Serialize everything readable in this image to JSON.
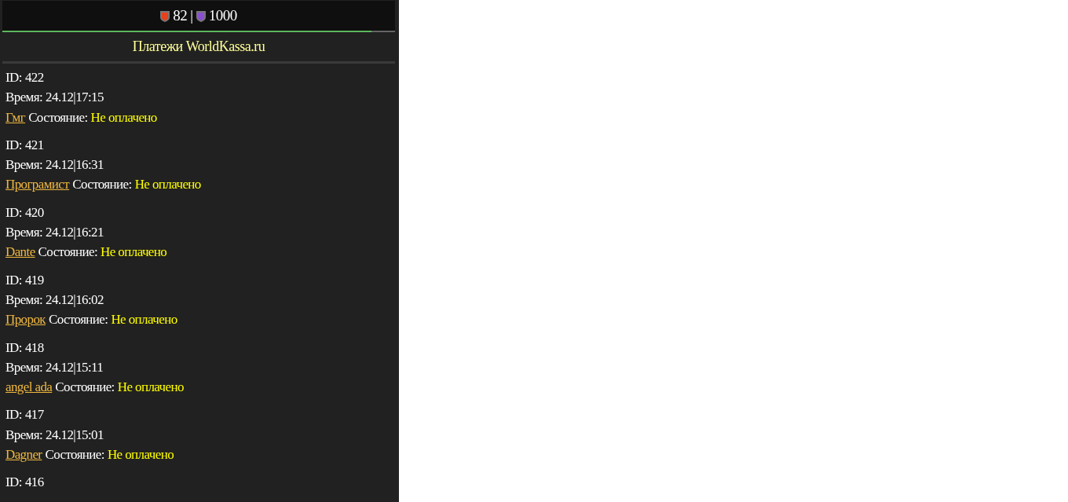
{
  "header": {
    "health": "82",
    "separator": "|",
    "mana": "1000",
    "bar": {
      "level": 0.94
    }
  },
  "title": "Платежи WorldKassa.ru",
  "payments": [
    {
      "id_label": "ID:",
      "id": "422",
      "time_label": "Время:",
      "time": "24.12|17:15",
      "player": "Гмг",
      "state_label": "Состояние:",
      "state": "Не оплачено"
    },
    {
      "id_label": "ID:",
      "id": "421",
      "time_label": "Время:",
      "time": "24.12|16:31",
      "player": "Програмист",
      "state_label": "Состояние:",
      "state": "Не оплачено"
    },
    {
      "id_label": "ID:",
      "id": "420",
      "time_label": "Время:",
      "time": "24.12|16:21",
      "player": "Dante",
      "state_label": "Состояние:",
      "state": "Не оплачено"
    },
    {
      "id_label": "ID:",
      "id": "419",
      "time_label": "Время:",
      "time": "24.12|16:02",
      "player": "Пророк",
      "state_label": "Состояние:",
      "state": "Не оплачено"
    },
    {
      "id_label": "ID:",
      "id": "418",
      "time_label": "Время:",
      "time": "24.12|15:11",
      "player": "angel ada",
      "state_label": "Состояние:",
      "state": "Не оплачено"
    },
    {
      "id_label": "ID:",
      "id": "417",
      "time_label": "Время:",
      "time": "24.12|15:01",
      "player": "Dagner",
      "state_label": "Состояние:",
      "state": "Не оплачено"
    },
    {
      "id_label": "ID:",
      "id": "416"
    }
  ]
}
